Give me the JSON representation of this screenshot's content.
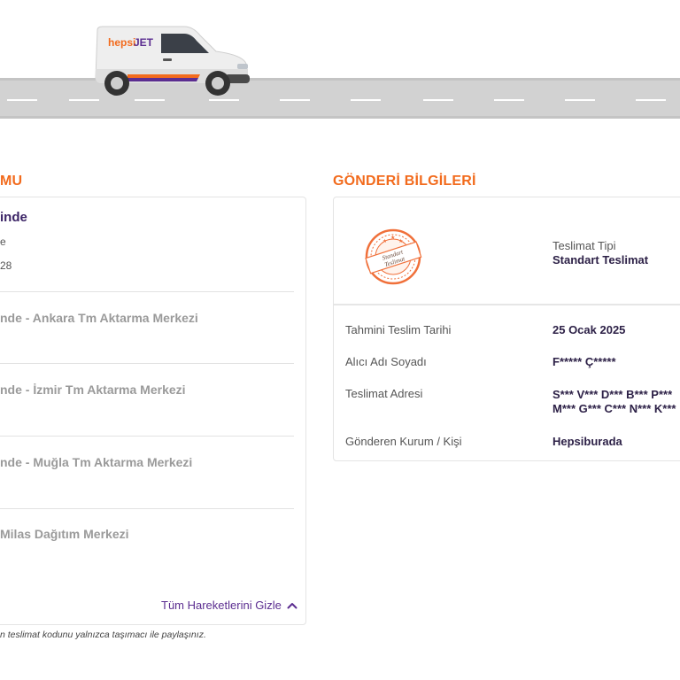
{
  "header": {
    "van_brand": {
      "prefix": "hepsi",
      "suffix": "JET"
    },
    "colors": {
      "brand_orange": "#f26b1d",
      "brand_purple": "#5b2d90",
      "road": "#d2d2d2"
    }
  },
  "tracking": {
    "section_title": "MU",
    "current": {
      "status": "inde",
      "line1": "e",
      "line2": "28"
    },
    "history": [
      "nde - Ankara Tm Aktarma Merkezi",
      "nde - İzmir Tm Aktarma Merkezi",
      "nde - Muğla Tm Aktarma Merkezi",
      "Milas Dağıtım Merkezi"
    ],
    "toggle_label": "Tüm Hareketlerini Gizle",
    "toggle_icon": "chevron-up-icon",
    "footnote": "n teslimat kodunu yalnızca taşımacı ile paylaşınız."
  },
  "shipment": {
    "section_title": "GÖNDERİ BİLGİLERİ",
    "stamp": {
      "line1": "Standart",
      "line2": "Teslimat",
      "icon": "standard-delivery-stamp-icon"
    },
    "type_label": "Teslimat Tipi",
    "type_value": "Standart Teslimat",
    "rows": [
      {
        "label": "Tahmini Teslim Tarihi",
        "value": "25 Ocak 2025"
      },
      {
        "label": "Alıcı Adı Soyadı",
        "value": "F***** Ç*****"
      },
      {
        "label": "Teslimat Adresi",
        "value": "S*** V*** D*** B*** P***",
        "value2": "M*** G*** C*** N*** K***"
      },
      {
        "label": "Gönderen Kurum / Kişi",
        "value": "Hepsiburada"
      }
    ]
  }
}
